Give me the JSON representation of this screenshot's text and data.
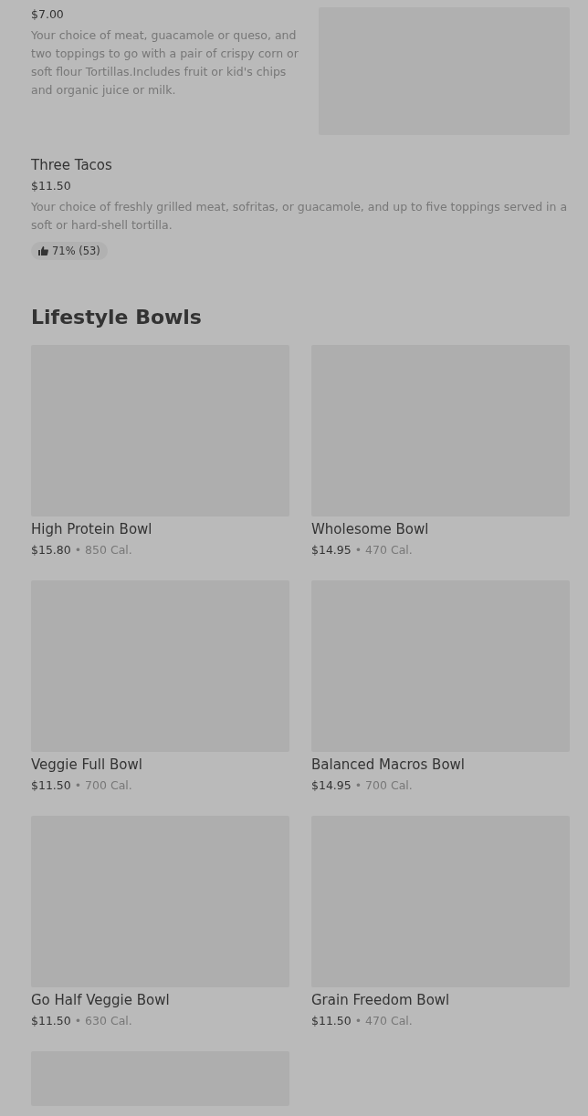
{
  "menu_items": [
    {
      "kind": "with_image",
      "price": "$7.00",
      "description": "Your choice of meat, guacamole or queso, and two toppings to go with a pair of crispy corn or soft flour Tortillas.Includes fruit or kid's chips and organic juice or milk."
    },
    {
      "kind": "text_only",
      "title": "Three Tacos",
      "price": "$11.50",
      "description": "Your choice of freshly grilled meat, sofritas, or guacamole, and up to five toppings served in a soft or hard-shell tortilla.",
      "rating": "71% (53)"
    }
  ],
  "section": {
    "title": "Lifestyle Bowls",
    "items": [
      {
        "kind": "full",
        "name": "High Protein Bowl",
        "price": "$15.80",
        "separator": "•",
        "calories": "850 Cal."
      },
      {
        "kind": "full",
        "name": "Wholesome Bowl",
        "price": "$14.95",
        "separator": "•",
        "calories": "470 Cal."
      },
      {
        "kind": "full",
        "name": "Veggie Full Bowl",
        "price": "$11.50",
        "separator": "•",
        "calories": "700 Cal."
      },
      {
        "kind": "full",
        "name": "Balanced Macros Bowl",
        "price": "$14.95",
        "separator": "•",
        "calories": "700 Cal."
      },
      {
        "kind": "full",
        "name": "Go Half Veggie Bowl",
        "price": "$11.50",
        "separator": "•",
        "calories": "630 Cal."
      },
      {
        "kind": "full",
        "name": "Grain Freedom Bowl",
        "price": "$11.50",
        "separator": "•",
        "calories": "470 Cal."
      },
      {
        "kind": "image_only"
      }
    ]
  }
}
